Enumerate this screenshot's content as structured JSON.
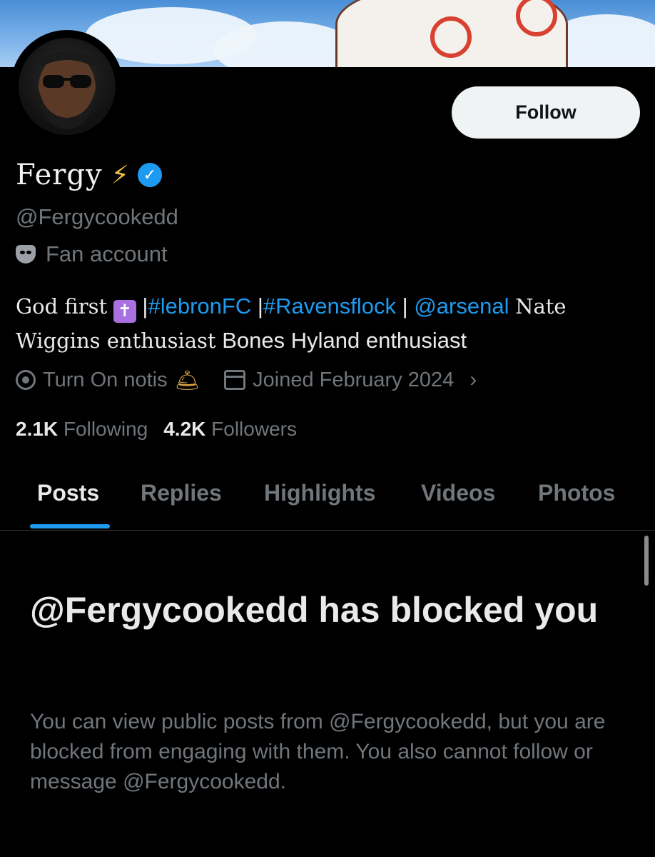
{
  "profile": {
    "name": "Fergy",
    "name_emoji": "⚡",
    "verified_mark": "✓",
    "handle": "@Fergycookedd",
    "category": "Fan account",
    "category_icon": "performing-arts-mask-icon"
  },
  "header": {
    "follow_label": "Follow"
  },
  "bio": {
    "text1": "God first",
    "cross_emoji": "✝",
    "sep": "|",
    "tag1": "#lebronFC",
    "tag2": "#Ravensflock",
    "mention": "@arsenal",
    "text2": "Nate Wiggins enthusiast",
    "text3": "Bones Hyland enthusiast"
  },
  "meta": {
    "location": "Turn On notis",
    "location_emoji": "🛎",
    "joined": "Joined February 2024",
    "chevron": "›"
  },
  "stats": {
    "following_count": "2.1K",
    "following_label": "Following",
    "followers_count": "4.2K",
    "followers_label": "Followers"
  },
  "tabs": [
    {
      "label": "Posts",
      "active": true
    },
    {
      "label": "Replies"
    },
    {
      "label": "Highlights"
    },
    {
      "label": "Videos"
    },
    {
      "label": "Photos"
    }
  ],
  "blocked": {
    "title": "@Fergycookedd has blocked you",
    "description": "You can view public posts from @Fergycookedd, but you are blocked from engaging with them. You also cannot follow or message @Fergycookedd."
  },
  "colors": {
    "accent": "#1d9bf0",
    "background": "#000000",
    "muted_text": "#71767b",
    "primary_text": "#e7e9ea"
  }
}
